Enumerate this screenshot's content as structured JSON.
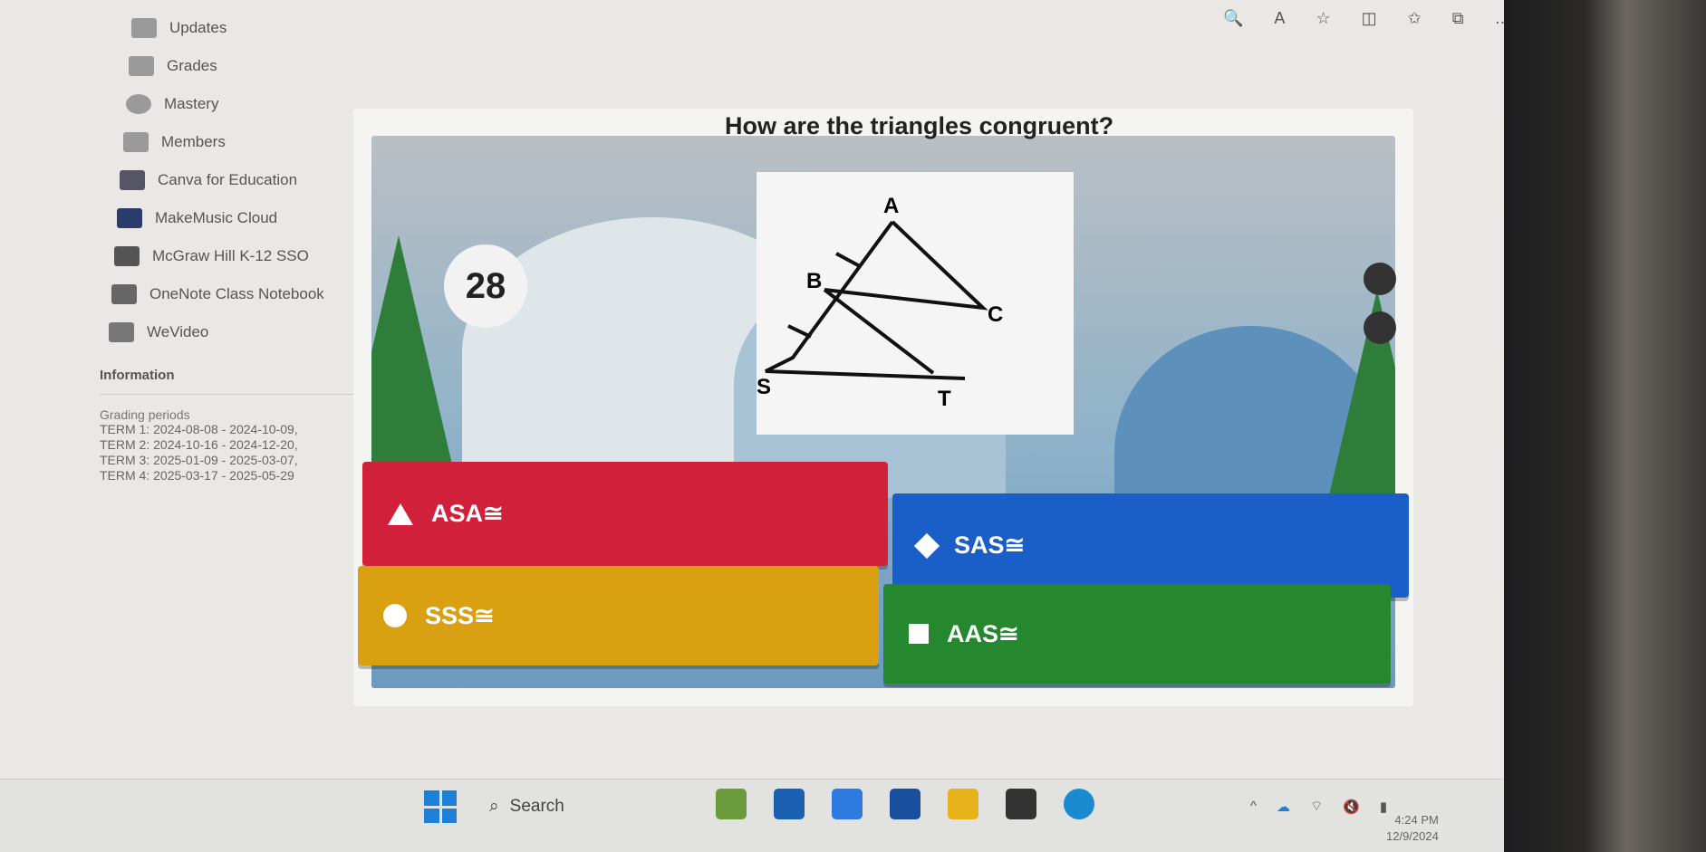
{
  "sidebar": {
    "items": [
      {
        "label": "Updates",
        "icon": "updates-icon"
      },
      {
        "label": "Grades",
        "icon": "grades-icon"
      },
      {
        "label": "Mastery",
        "icon": "mastery-icon"
      },
      {
        "label": "Members",
        "icon": "members-icon"
      },
      {
        "label": "Canva for Education",
        "icon": "canva-icon"
      },
      {
        "label": "MakeMusic Cloud",
        "icon": "makemusic-icon"
      },
      {
        "label": "McGraw Hill K-12 SSO",
        "icon": "mcgraw-hill-icon"
      },
      {
        "label": "OneNote Class Notebook",
        "icon": "onenote-icon"
      },
      {
        "label": "WeVideo",
        "icon": "wevideo-icon"
      }
    ],
    "information_title": "Information",
    "grading_label": "Grading periods",
    "grading_text": "TERM 1: 2024-08-08 - 2024-10-09, TERM 2: 2024-10-16 - 2024-12-20, TERM 3: 2025-01-09 - 2025-03-07, TERM 4: 2025-03-17 - 2025-05-29"
  },
  "quiz": {
    "question": "How are the triangles congruent?",
    "counter": "28",
    "figure_labels": {
      "A": "A",
      "B": "B",
      "C": "C",
      "S": "S",
      "T": "T"
    },
    "answers": [
      {
        "label": "ASA≅",
        "shape": "triangle",
        "color": "#d0203a"
      },
      {
        "label": "SAS≅",
        "shape": "diamond",
        "color": "#1a5fc8"
      },
      {
        "label": "SSS≅",
        "shape": "circle",
        "color": "#d9a111"
      },
      {
        "label": "AAS≅",
        "shape": "square",
        "color": "#26882e"
      }
    ]
  },
  "taskbar": {
    "search_placeholder": "Search",
    "time": "4:24 PM",
    "date": "12/9/2024"
  }
}
